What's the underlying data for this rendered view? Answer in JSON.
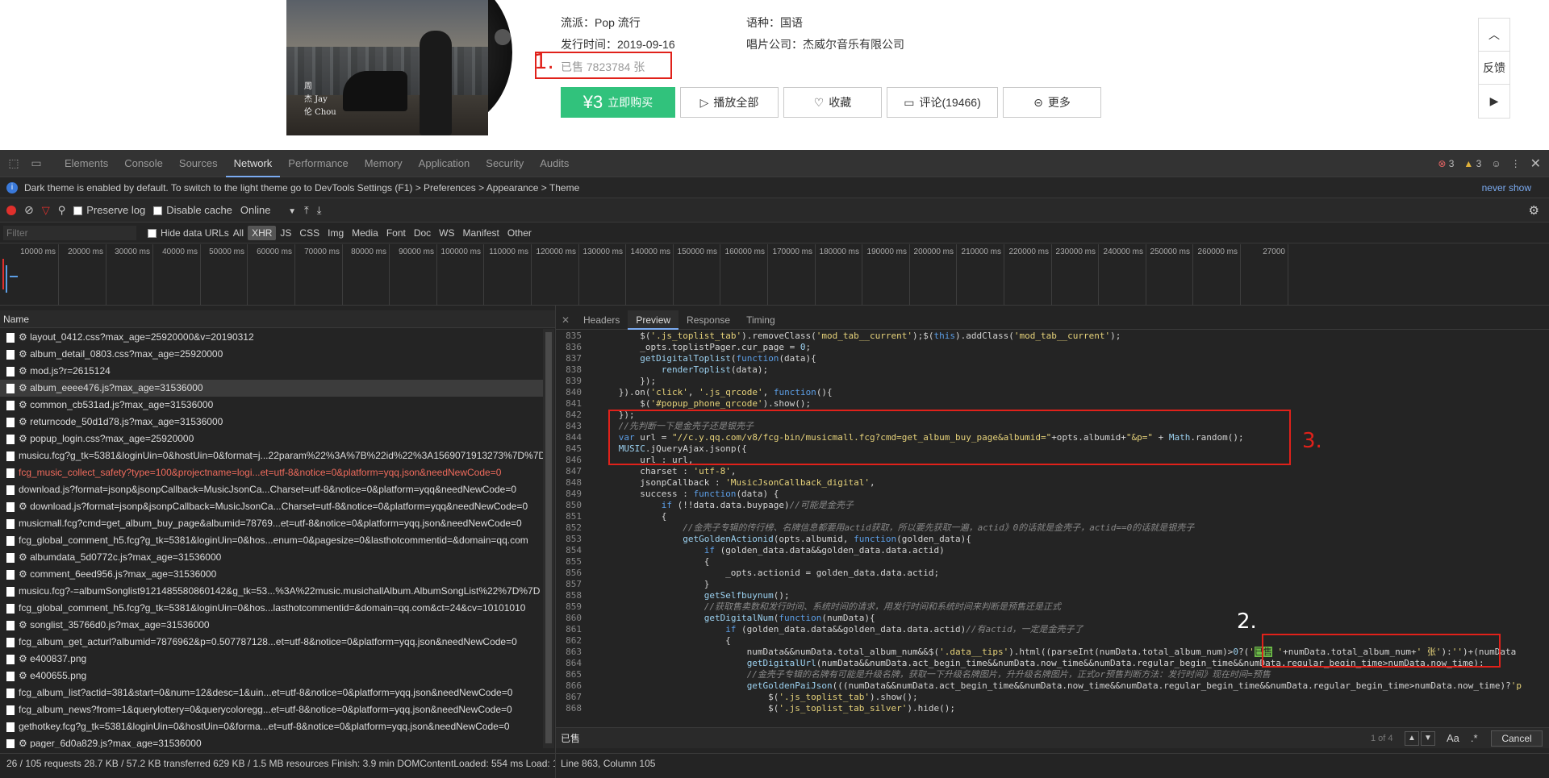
{
  "album": {
    "cover_text": [
      "周",
      "杰  Jay",
      "伦  Chou"
    ],
    "genre_label": "流派：",
    "genre": "Pop 流行",
    "language_label": "语种：",
    "language": "国语",
    "release_label": "发行时间：",
    "release": "2019-09-16",
    "company_label": "唱片公司：",
    "company": "杰威尔音乐有限公司",
    "sold_text": "已售 7823784 张",
    "buttons": {
      "buy_price": "¥3",
      "buy_label": "立即购买",
      "play_label": "播放全部",
      "fav_label": "收藏",
      "comment_label": "评论(19466)",
      "more_label": "更多"
    },
    "side_tools": {
      "top_icon": "arrow-up-icon",
      "feedback_label": "反馈",
      "play_icon": "video-icon"
    }
  },
  "annotations": {
    "one": "1.",
    "two": "2.",
    "three": "3.",
    "color": "#e0211a"
  },
  "devtools": {
    "tabs": [
      "Elements",
      "Console",
      "Sources",
      "Network",
      "Performance",
      "Memory",
      "Application",
      "Security",
      "Audits"
    ],
    "active_tab": "Network",
    "error_count": "3",
    "warning_count": "3",
    "info_message": "Dark theme is enabled by default. To switch to the light theme go to DevTools Settings (F1) > Preferences > Appearance > Theme",
    "never_show": "never show",
    "toolbar": {
      "preserve_log": "Preserve log",
      "disable_cache": "Disable cache",
      "online": "Online"
    },
    "filter": {
      "placeholder": "Filter",
      "hide_data_urls": "Hide data URLs",
      "types": [
        "All",
        "XHR",
        "JS",
        "CSS",
        "Img",
        "Media",
        "Font",
        "Doc",
        "WS",
        "Manifest",
        "Other"
      ],
      "selected_type": "XHR"
    },
    "timeline_ticks": [
      "10000 ms",
      "20000 ms",
      "30000 ms",
      "40000 ms",
      "50000 ms",
      "60000 ms",
      "70000 ms",
      "80000 ms",
      "90000 ms",
      "100000 ms",
      "110000 ms",
      "120000 ms",
      "130000 ms",
      "140000 ms",
      "150000 ms",
      "160000 ms",
      "170000 ms",
      "180000 ms",
      "190000 ms",
      "200000 ms",
      "210000 ms",
      "220000 ms",
      "230000 ms",
      "240000 ms",
      "250000 ms",
      "260000 ms",
      "27000"
    ],
    "name_header": "Name",
    "requests": [
      {
        "name": "⚙ layout_0412.css?max_age=25920000&v=20190312",
        "state": ""
      },
      {
        "name": "⚙ album_detail_0803.css?max_age=25920000",
        "state": ""
      },
      {
        "name": "⚙ mod.js?r=2615124",
        "state": ""
      },
      {
        "name": "⚙ album_eeee476.js?max_age=31536000",
        "state": "selected"
      },
      {
        "name": "⚙ common_cb531ad.js?max_age=31536000",
        "state": ""
      },
      {
        "name": "⚙ returncode_50d1d78.js?max_age=31536000",
        "state": ""
      },
      {
        "name": "⚙ popup_login.css?max_age=25920000",
        "state": ""
      },
      {
        "name": "musicu.fcg?g_tk=5381&loginUin=0&hostUin=0&format=j...22param%22%3A%7B%22id%22%3A1569071913273%7D%7D...",
        "state": ""
      },
      {
        "name": "fcg_music_collect_safety?type=100&projectname=logi...et=utf-8&notice=0&platform=yqq.json&needNewCode=0",
        "state": "error"
      },
      {
        "name": "download.js?format=jsonp&jsonpCallback=MusicJsonCa...Charset=utf-8&notice=0&platform=yqq&needNewCode=0",
        "state": ""
      },
      {
        "name": "⚙ download.js?format=jsonp&jsonpCallback=MusicJsonCa...Charset=utf-8&notice=0&platform=yqq&needNewCode=0",
        "state": ""
      },
      {
        "name": "musicmall.fcg?cmd=get_album_buy_page&albumid=78769...et=utf-8&notice=0&platform=yqq.json&needNewCode=0",
        "state": ""
      },
      {
        "name": "fcg_global_comment_h5.fcg?g_tk=5381&loginUin=0&hos...enum=0&pagesize=0&lasthotcommentid=&domain=qq.com",
        "state": ""
      },
      {
        "name": "⚙ albumdata_5d0772c.js?max_age=31536000",
        "state": ""
      },
      {
        "name": "⚙ comment_6eed956.js?max_age=31536000",
        "state": ""
      },
      {
        "name": "musicu.fcg?-=albumSonglist9121485580860142&g_tk=53...%3A%22music.musichallAlbum.AlbumSongList%22%7D%7D",
        "state": ""
      },
      {
        "name": "fcg_global_comment_h5.fcg?g_tk=5381&loginUin=0&hos...lasthotcommentid=&domain=qq.com&ct=24&cv=10101010",
        "state": ""
      },
      {
        "name": "⚙ songlist_35766d0.js?max_age=31536000",
        "state": ""
      },
      {
        "name": "fcg_album_get_acturl?albumid=7876962&p=0.507787128...et=utf-8&notice=0&platform=yqq.json&needNewCode=0",
        "state": ""
      },
      {
        "name": "⚙ e400837.png",
        "state": ""
      },
      {
        "name": "⚙ e400655.png",
        "state": ""
      },
      {
        "name": "fcg_album_list?actid=381&start=0&num=12&desc=1&uin...et=utf-8&notice=0&platform=yqq.json&needNewCode=0",
        "state": ""
      },
      {
        "name": "fcg_album_news?from=1&querylottery=0&querycoloregg...et=utf-8&notice=0&platform=yqq.json&needNewCode=0",
        "state": ""
      },
      {
        "name": "gethotkey.fcg?g_tk=5381&loginUin=0&hostUin=0&forma...et=utf-8&notice=0&platform=yqq.json&needNewCode=0",
        "state": ""
      },
      {
        "name": "⚙ pager_6d0a829.js?max_age=31536000",
        "state": ""
      }
    ],
    "status": "26 / 105 requests   28.7 KB / 57.2 KB transferred   629 KB / 1.5 MB resources   Finish: 3.9 min   DOMContentLoaded: 554 ms   Load: 1",
    "detail_tabs": [
      "Headers",
      "Preview",
      "Response",
      "Timing"
    ],
    "active_detail_tab": "Preview",
    "line_numbers": [
      "835",
      "836",
      "837",
      "838",
      "839",
      "840",
      "841",
      "842",
      "843",
      "844",
      "845",
      "846",
      "847",
      "848",
      "849",
      "850",
      "851",
      "852",
      "853",
      "854",
      "855",
      "856",
      "857",
      "858",
      "859",
      "860",
      "861",
      "862",
      "863",
      "864",
      "865",
      "866",
      "867",
      "868"
    ],
    "find": {
      "value": "已售",
      "count": "1 of 4",
      "match_case": "Aa",
      "regex": ".*",
      "cancel": "Cancel"
    },
    "cursor_position": "Line 863, Column 105"
  }
}
